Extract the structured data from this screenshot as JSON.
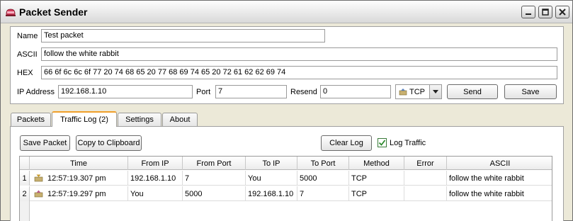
{
  "window": {
    "title": "Packet Sender"
  },
  "form": {
    "name_label": "Name",
    "name_value": "Test packet",
    "ascii_label": "ASCII",
    "ascii_value": "follow the white rabbit",
    "hex_label": "HEX",
    "hex_value": "66 6f 6c 6c 6f 77 20 74 68 65 20 77 68 69 74 65 20 72 61 62 62 69 74",
    "ip_label": "IP Address",
    "ip_value": "192.168.1.10",
    "port_label": "Port",
    "port_value": "7",
    "resend_label": "Resend",
    "resend_value": "0",
    "protocol_value": "TCP",
    "send_label": "Send",
    "save_label": "Save"
  },
  "tabs": [
    {
      "label": "Packets"
    },
    {
      "label": "Traffic Log (2)",
      "active": true
    },
    {
      "label": "Settings"
    },
    {
      "label": "About"
    }
  ],
  "log": {
    "save_packet_label": "Save Packet",
    "copy_label": "Copy to Clipboard",
    "clear_label": "Clear Log",
    "log_traffic_label": "Log Traffic",
    "log_traffic_checked": true,
    "columns": [
      "Time",
      "From IP",
      "From Port",
      "To IP",
      "To Port",
      "Method",
      "Error",
      "ASCII"
    ],
    "rows": [
      {
        "num": "1",
        "icon": "received-packet-icon",
        "time": "12:57:19.307 pm",
        "from_ip": "192.168.1.10",
        "from_port": "7",
        "to_ip": "You",
        "to_port": "5000",
        "method": "TCP",
        "error": "",
        "ascii": "follow the white rabbit"
      },
      {
        "num": "2",
        "icon": "sent-packet-icon",
        "time": "12:57:19.297 pm",
        "from_ip": "You",
        "from_port": "5000",
        "to_ip": "192.168.1.10",
        "to_port": "7",
        "method": "TCP",
        "error": "",
        "ascii": "follow the white rabbit"
      }
    ]
  },
  "colors": {
    "active_tab_accent": "#f0a02a",
    "checkbox_check": "#2e8b2e"
  }
}
